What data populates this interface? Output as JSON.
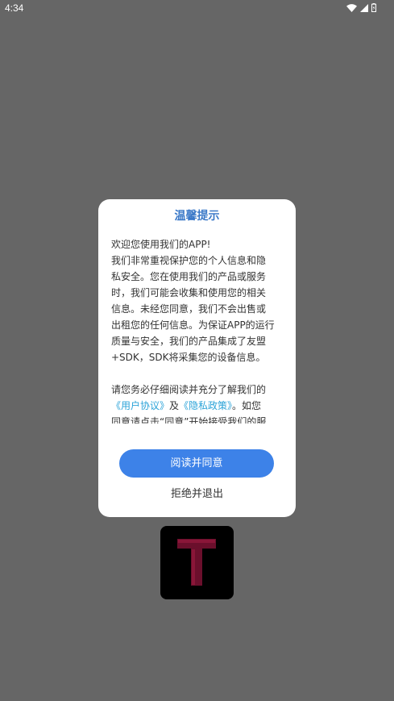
{
  "status_bar": {
    "time": "4:34",
    "icons": [
      "wifi-icon",
      "cellular-signal-icon",
      "battery-icon"
    ]
  },
  "dialog": {
    "title": "温馨提示",
    "paragraph1_lines": [
      "欢迎您使用我们的APP!",
      "我们非常重视保护您的个人信息和隐",
      "私安全。您在使用我们的产品或服务",
      "时，我们可能会收集和使用您的相关",
      "信息。未经您同意，我们不会出售或",
      "出租您的任何信息。为保证APP的运行",
      "质量与安全，我们的产品集成了友盟",
      "+SDK，SDK将采集您的设备信息。"
    ],
    "paragraph2_line1": "请您务必仔细阅读并充分了解我们的",
    "user_agreement_link": "《用户协议》",
    "and_text": "及",
    "privacy_policy_link": "《隐私政策》",
    "paragraph2_line2_tail": "。如您",
    "paragraph2_line3": "同意请点击“同意”开始接受我们的服",
    "accept_label": "阅读并同意",
    "reject_label": "拒绝并退出"
  },
  "colors": {
    "backdrop": "#666666",
    "title": "#3b79c8",
    "link": "#2ba3d8",
    "accept_button": "#3d82e8",
    "logo_letter": "#6b0f2c"
  },
  "logo": {
    "icon": "t-letter-logo-icon"
  }
}
